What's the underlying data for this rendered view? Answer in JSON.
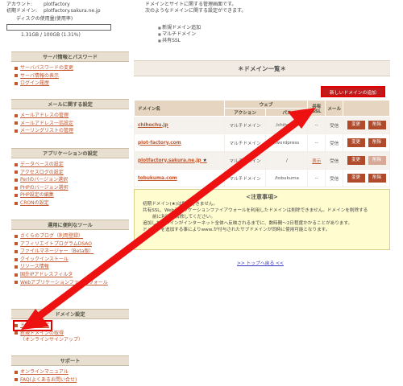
{
  "account": {
    "account_label": "アカウント:",
    "account_value": "plotfactory",
    "domain_label": "初期ドメイン:",
    "domain_value": "plotfactory.sakura.ne.jp",
    "disk_label": "ディスクの使用量(使用率)",
    "disk_text": "1.31GB / 100GB (1.31%)"
  },
  "sections": [
    {
      "title": "サーバ情報とパスワード",
      "items": [
        "サーバパスワードの変更",
        "サーバ情報の表示",
        "ログイン履歴"
      ]
    },
    {
      "title": "メールに関する設定",
      "items": [
        "メールアドレスの管理",
        "メールアドレス一括設定",
        "メーリングリストの管理"
      ]
    },
    {
      "title": "アプリケーションの設定",
      "items": [
        "データベースの設定",
        "アクセスログの設定",
        "Perlのバージョン選択",
        "PHPのバージョン選択",
        "PHP設定の編集",
        "CRONの設定"
      ]
    },
    {
      "title": "運用に便利なツール",
      "items": [
        "さくらのブログ（利用登録）",
        "アフィリエイトプログラムDSAO",
        "ファイルマネージャー（Beta版）",
        "クイックインストール",
        "リソース情報",
        "国外IPアドレスフィルタ",
        "Webアプリケーションファイアウォール"
      ]
    },
    {
      "title": "ドメイン設定",
      "items": [
        "ドメイン設定",
        "新規ドメインの取得"
      ],
      "sub": "（オンラインサインアップ）"
    },
    {
      "title": "サポート",
      "items": [
        "オンラインマニュアル",
        "FAQ(よくあるお問い合せ)"
      ]
    }
  ],
  "intro": {
    "line1": "ドメインとサイトに関する管理画面です。",
    "line2": "次のようなドメインに関する設定ができます。",
    "bullets": [
      "新規ドメイン追加",
      "マルチドメイン",
      "共有SSL"
    ]
  },
  "main": {
    "list_title": "＊ドメイン一覧＊",
    "new_domain_button": "新しいドメインの追加",
    "headers": {
      "domain": "ドメイン名",
      "web": "ウェブ",
      "action": "アクション",
      "path": "パス",
      "shared": "共有",
      "ssl": "SSL",
      "mail": "メール"
    },
    "rows": [
      {
        "domain": "chihochu.jp",
        "action": "マルチドメイン",
        "path": "/chihochu",
        "shared": "--",
        "mail": "受信",
        "edit": "変更",
        "del": "削除",
        "star": ""
      },
      {
        "domain": "plot-factory.com",
        "action": "マルチドメイン",
        "path": "/wordpress",
        "shared": "--",
        "mail": "受信",
        "edit": "変更",
        "del": "削除",
        "star": ""
      },
      {
        "domain": "plotfactory.sakura.ne.jp",
        "action": "マルチドメイン",
        "path": "/",
        "shared": "表示",
        "mail": "受信",
        "edit": "変更",
        "del": "削除",
        "star": "★"
      },
      {
        "domain": "tobukuma.com",
        "action": "マルチドメイン",
        "path": "/tobukuma",
        "shared": "--",
        "mail": "受信",
        "edit": "変更",
        "del": "削除",
        "star": ""
      }
    ]
  },
  "notice": {
    "title": "<注意事項>",
    "lines": [
      "初期ドメイン(★)は削除できません。",
      "共有SSL、Webアプリケーションファイアウォールを利用したドメインは削除できません。ドメインを削除する",
      "前に利用を解除してください。",
      "追加したドメインがインターネット全体へ反映されるまでに、数時間～2日程度かかることがあります。",
      "ドメインを追加する事によりwww.が付与されたサブドメインが同時に使用可能となります。"
    ]
  },
  "top_link": ">> トップへ戻る <<",
  "colors": {
    "accent": "#c2552a",
    "highlight": "#e00000",
    "header_bg": "#e6d6c1"
  }
}
